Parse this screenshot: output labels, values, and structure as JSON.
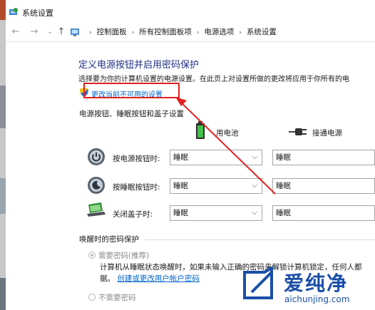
{
  "window": {
    "title": "系统设置"
  },
  "nav": {
    "back": "←",
    "forward": "→",
    "recent": "⌄",
    "up": "↑",
    "crumbs": [
      "控制面板",
      "所有控制面板项",
      "电源选项",
      "系统设置"
    ],
    "crumb_sep": "›",
    "root_arrow": "›"
  },
  "main": {
    "title": "定义电源按钮并启用密码保护",
    "description": "选择要为你的计算机设置的电源设置。在此页上对设置所做的更改将应用于你所有的电",
    "change_link": "更改当前不可用的设置",
    "section_buttons": "电源按钮、睡眠按钮和盖子设置",
    "col_battery": "用电池",
    "col_plugged": "接通电源",
    "rows": [
      {
        "label": "按电源按钮时:",
        "battery": "睡眠",
        "plugged": "睡眠"
      },
      {
        "label": "按睡眠按钮时:",
        "battery": "睡眠",
        "plugged": "睡眠"
      },
      {
        "label": "关闭盖子时:",
        "battery": "睡眠",
        "plugged": "睡眠"
      }
    ],
    "section_password": "唤醒时的密码保护",
    "option_require": "需要密码(推荐)",
    "require_desc_1": "计算机从睡眠状态唤醒时，如果未输入正确的密码来解锁计算机锁定，任何人都",
    "require_desc_2_prefix": "据。",
    "require_desc_2_link": "创建或更改用户帐户密码",
    "option_no_require": "不需要密码"
  },
  "watermark": {
    "brand": "爱纯净",
    "url": "aichunjing.com"
  },
  "colors": {
    "title_blue": "#1e3287",
    "link_blue": "#0066cc",
    "highlight_red": "#e32020",
    "watermark_blue": "#1a4fa8"
  }
}
